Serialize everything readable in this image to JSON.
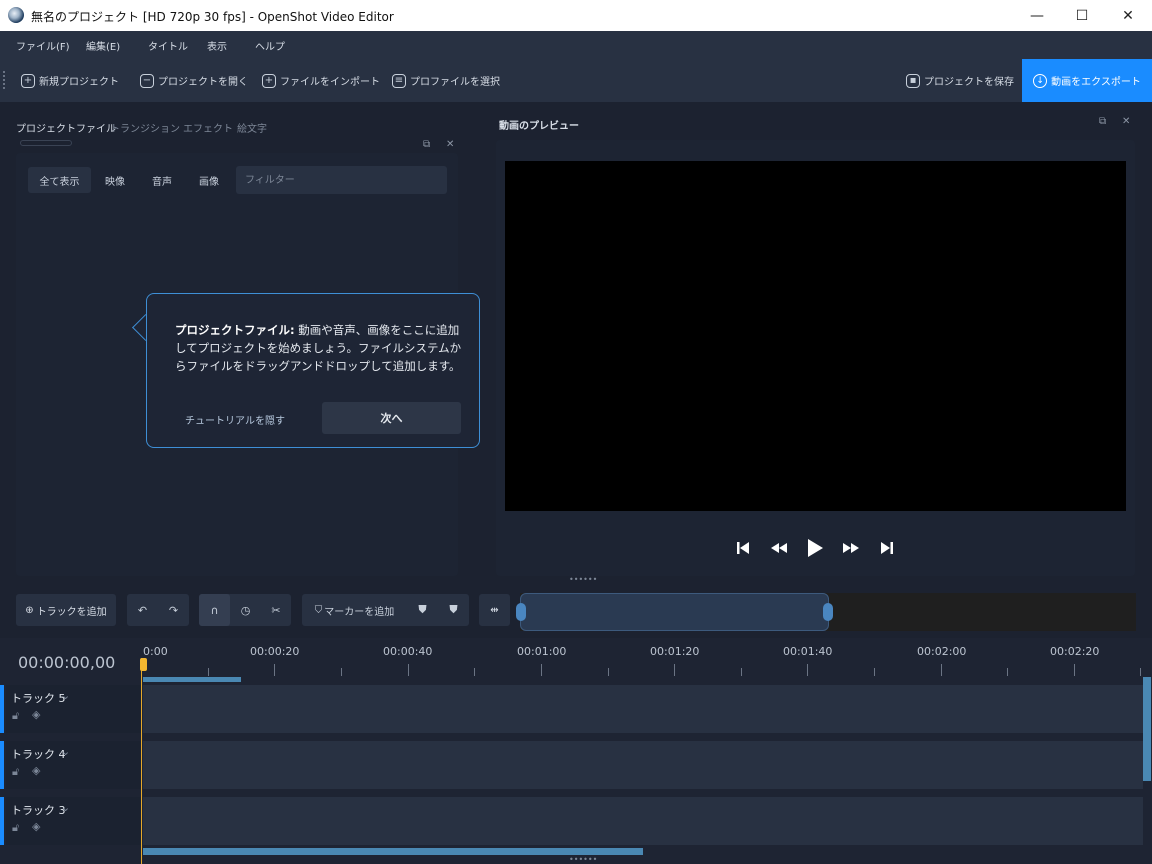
{
  "window": {
    "title": "無名のプロジェクト [HD 720p 30 fps] - OpenShot Video Editor",
    "minimize": "—",
    "maximize": "☐",
    "close": "✕"
  },
  "menu": [
    "ファイル(F)",
    "編集(E)",
    "タイトル",
    "表示",
    "ヘルプ"
  ],
  "toolbar": {
    "new_project": "新規プロジェクト",
    "open_project": "プロジェクトを開く",
    "import_files": "ファイルをインポート",
    "choose_profile": "プロファイルを選択",
    "save_project": "プロジェクトを保存",
    "export_video": "動画をエクスポート"
  },
  "left_tabs": [
    "プロジェクトファイル",
    "トランジション",
    "エフェクト",
    "絵文字"
  ],
  "filter_tabs": [
    "全て表示",
    "映像",
    "音声",
    "画像"
  ],
  "filter": {
    "placeholder": "フィルター"
  },
  "tutorial": {
    "bold": "プロジェクトファイル:",
    "text": " 動画や音声、画像をここに追加してプロジェクトを始めましょう。ファイルシステムからファイルをドラッグアンドドロップして追加します。",
    "hide": "チュートリアルを隠す",
    "next": "次へ"
  },
  "preview": {
    "title": "動画のプレビュー"
  },
  "timeline_toolbar": {
    "add_track": "トラックを追加",
    "add_marker": "マーカーを追加"
  },
  "timeline": {
    "timecode": "00:00:00,00",
    "ticks": [
      "0:00",
      "00:00:20",
      "00:00:40",
      "00:01:00",
      "00:01:20",
      "00:01:40",
      "00:02:00",
      "00:02:20"
    ],
    "tracks": [
      "トラック 5",
      "トラック 4",
      "トラック 3"
    ]
  },
  "colors": {
    "accent": "#1a8cff",
    "panel": "#1d2433",
    "toolbar": "#283142",
    "playhead": "#f2b630"
  }
}
